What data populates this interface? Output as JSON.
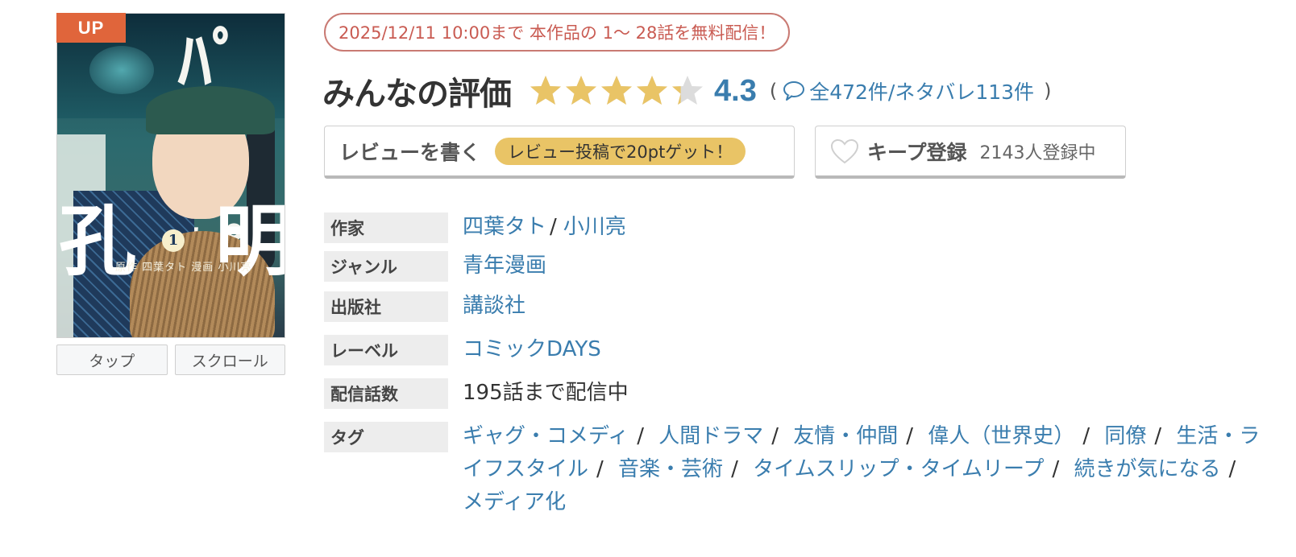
{
  "cover": {
    "badge": "UP",
    "title_fragment": "ﾊﾟリピ",
    "kanji_left": "孔",
    "kanji_right": "明",
    "volume": "1",
    "credit": "原作 四葉タト 漫画 小川亮"
  },
  "view_buttons": {
    "tap": "タップ",
    "scroll": "スクロール"
  },
  "promo": "2025/12/11 10:00まで 本作品の 1～ 28話を無料配信！",
  "rating": {
    "title": "みんなの評価",
    "value": "4.3",
    "stars": 4.3,
    "open_paren": "(",
    "close_paren": ")",
    "reviews": "全472件/ネタバレ113件",
    "star_color": "#e9c466",
    "empty_star_color": "#dcdcdc"
  },
  "review_button": {
    "label": "レビューを書く",
    "pill": "レビュー投稿で20ptゲット！"
  },
  "keep_button": {
    "label": "キープ登録",
    "count": "2143人登録中"
  },
  "info": {
    "author": {
      "label": "作家",
      "names": [
        "四葉タト",
        "小川亮"
      ]
    },
    "genre": {
      "label": "ジャンル",
      "value": "青年漫画"
    },
    "publisher": {
      "label": "出版社",
      "value": "講談社"
    },
    "imprint": {
      "label": "レーベル",
      "value": "コミックDAYS"
    },
    "episodes": {
      "label": "配信話数",
      "value": "195話まで配信中"
    },
    "tags": {
      "label": "タグ",
      "items": [
        "ギャグ・コメディ",
        "人間ドラマ",
        "友情・仲間",
        "偉人（世界史）",
        "同僚",
        "生活・ライフスタイル",
        "音楽・芸術",
        "タイムスリップ・タイムリープ",
        "続きが気になる",
        "メディア化"
      ]
    }
  },
  "colors": {
    "link": "#3a7dae",
    "promo": "#c95b52",
    "badge": "#e0653b"
  }
}
